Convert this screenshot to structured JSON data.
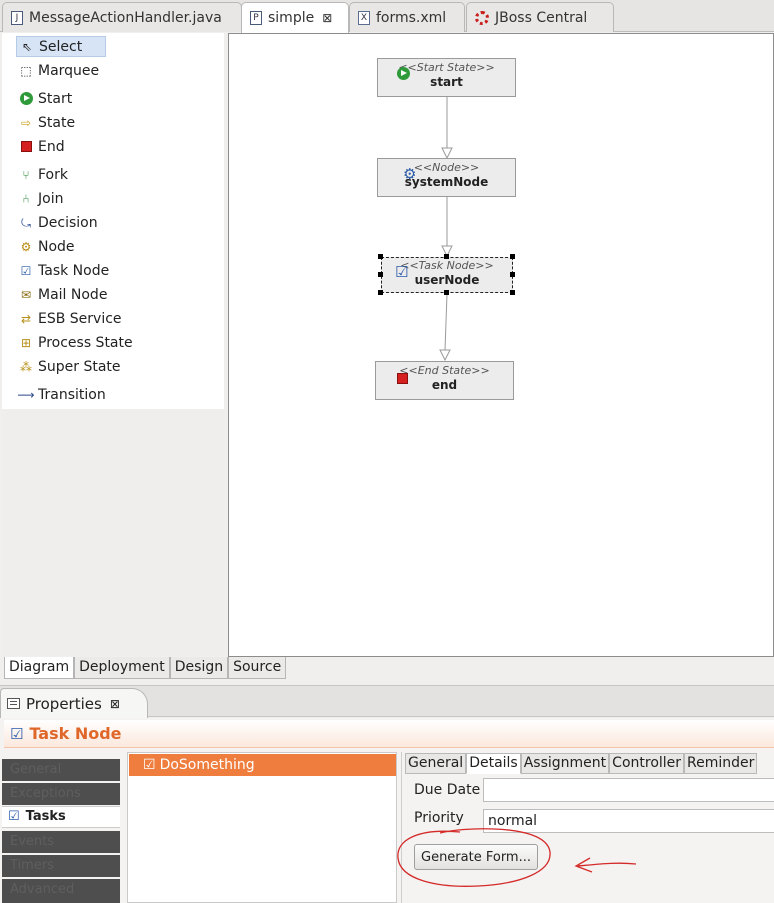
{
  "editor_tabs": [
    {
      "label": "MessageActionHandler.java",
      "icon": "java-file-icon",
      "glyph": "J"
    },
    {
      "label": "simple",
      "icon": "process-file-icon",
      "glyph": "P"
    },
    {
      "label": "forms.xml",
      "icon": "xml-file-icon",
      "glyph": "X"
    },
    {
      "label": "JBoss Central",
      "icon": "jboss-icon"
    }
  ],
  "close_glyph": "⊠",
  "palette": {
    "items": [
      {
        "label": "Select",
        "icon": "pointer-icon",
        "glyph": "⇖"
      },
      {
        "label": "Marquee",
        "icon": "marquee-icon",
        "glyph": "⬚"
      },
      {
        "label": "Start",
        "icon": "start-icon"
      },
      {
        "label": "State",
        "icon": "state-icon",
        "glyph": "⇨"
      },
      {
        "label": "End",
        "icon": "end-icon"
      },
      {
        "label": "Fork",
        "icon": "fork-icon",
        "glyph": "⑂"
      },
      {
        "label": "Join",
        "icon": "join-icon",
        "glyph": "⑃"
      },
      {
        "label": "Decision",
        "icon": "decision-icon",
        "glyph": "⤿"
      },
      {
        "label": "Node",
        "icon": "gear-icon",
        "glyph": "⚙"
      },
      {
        "label": "Task Node",
        "icon": "task-node-icon",
        "glyph": "☑"
      },
      {
        "label": "Mail Node",
        "icon": "mail-node-icon",
        "glyph": "✉"
      },
      {
        "label": "ESB Service",
        "icon": "esb-service-icon",
        "glyph": "⇄"
      },
      {
        "label": "Process State",
        "icon": "process-state-icon",
        "glyph": "⊞"
      },
      {
        "label": "Super State",
        "icon": "super-state-icon",
        "glyph": "⁂"
      },
      {
        "label": "Transition",
        "icon": "transition-arrow-icon",
        "glyph": "⟶"
      }
    ]
  },
  "diagram": {
    "nodes": [
      {
        "stereotype": "<<Start State>>",
        "name": "start",
        "icon": "start-icon"
      },
      {
        "stereotype": "<<Node>>",
        "name": "systemNode",
        "icon": "gear-icon"
      },
      {
        "stereotype": "<<Task Node>>",
        "name": "userNode",
        "icon": "task-node-icon"
      },
      {
        "stereotype": "<<End State>>",
        "name": "end",
        "icon": "end-icon"
      }
    ],
    "selected_node": "userNode"
  },
  "editor_bottom_tabs": [
    "Diagram",
    "Deployment",
    "Design",
    "Source"
  ],
  "properties": {
    "view_title": "Properties",
    "header_title": "Task Node",
    "categories": [
      "General",
      "Exceptions",
      "Tasks",
      "Events",
      "Timers",
      "Advanced"
    ],
    "active_category": "Tasks",
    "tasks": [
      {
        "label": "DoSomething"
      }
    ],
    "detail_tabs": [
      "General",
      "Details",
      "Assignment",
      "Controller",
      "Reminder"
    ],
    "active_detail_tab": "Details",
    "fields": {
      "due_date_label": "Due Date",
      "due_date_value": "",
      "priority_label": "Priority",
      "priority_value": "normal"
    },
    "generate_form_label": "Generate Form..."
  },
  "colors": {
    "accent": "#ee7d3e",
    "header_title": "#e0672a",
    "annotation": "#d42a2a",
    "start_green": "#2e9a3a",
    "end_red": "#d62020"
  }
}
